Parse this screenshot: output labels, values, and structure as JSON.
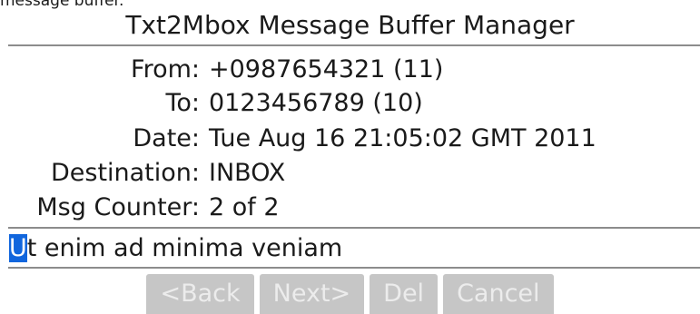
{
  "top_caption": "message buffer.",
  "title": "Txt2Mbox Message Buffer Manager",
  "fields": [
    {
      "label": "From:",
      "value": "+0987654321 (11)"
    },
    {
      "label": "To:",
      "value": "0123456789 (10)"
    },
    {
      "label": "Date:",
      "value": "Tue Aug 16 21:05:02 GMT 2011"
    },
    {
      "label": "Destination:",
      "value": "INBOX"
    },
    {
      "label": "Msg Counter:",
      "value": "2 of 2"
    }
  ],
  "message": {
    "cursor_char": "U",
    "rest": "t enim ad minima veniam"
  },
  "buttons": {
    "back": "<Back",
    "next": "Next>",
    "del": "Del",
    "cancel": "Cancel"
  },
  "colors": {
    "cursor": "#1166dd",
    "button_bg": "#c6c6c6",
    "button_text": "#ececec",
    "divider": "#8c8c8c"
  }
}
